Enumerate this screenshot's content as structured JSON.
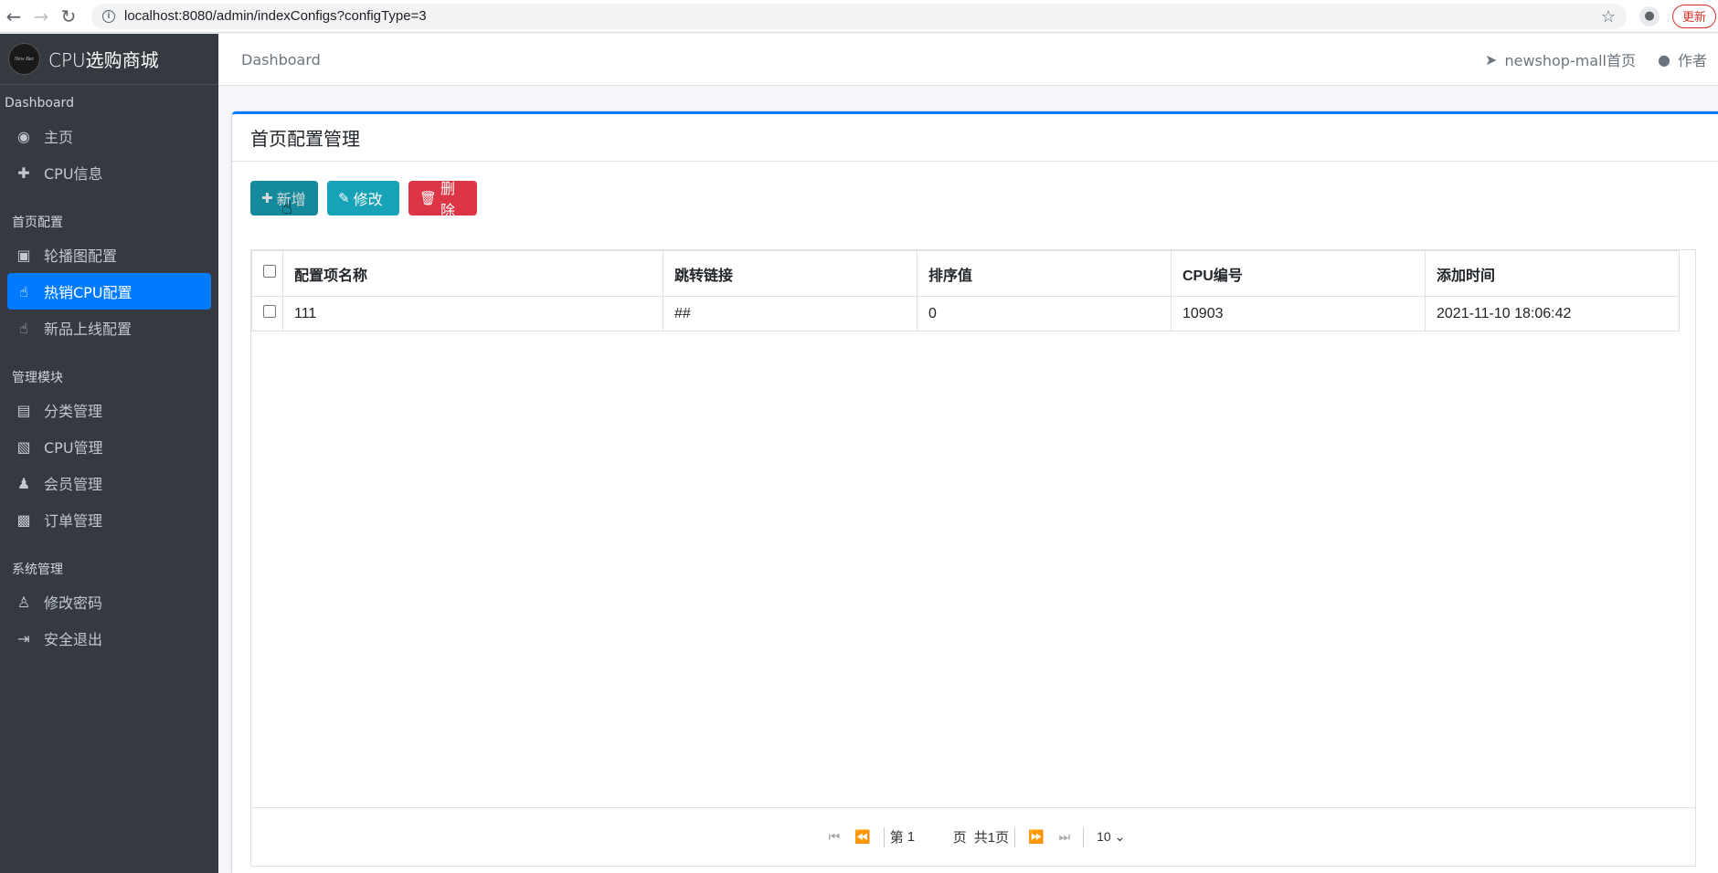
{
  "browser": {
    "url": "localhost:8080/admin/indexConfigs?configType=3",
    "update_label": "更新"
  },
  "sidebar": {
    "brand_logo_text": "New Bee",
    "brand_title": "CPU选购商城",
    "sections": [
      {
        "header": "Dashboard",
        "items": [
          {
            "label": "主页",
            "icon": "dashboard-icon"
          },
          {
            "label": "CPU信息",
            "icon": "plus-icon"
          }
        ]
      },
      {
        "header": "首页配置",
        "items": [
          {
            "label": "轮播图配置",
            "icon": "image-icon"
          },
          {
            "label": "热销CPU配置",
            "icon": "hand-pointer-icon",
            "active": true
          },
          {
            "label": "新品上线配置",
            "icon": "hand-pointer-icon"
          }
        ]
      },
      {
        "header": "管理模块",
        "items": [
          {
            "label": "分类管理",
            "icon": "list-icon"
          },
          {
            "label": "CPU管理",
            "icon": "archive-icon"
          },
          {
            "label": "会员管理",
            "icon": "users-icon"
          },
          {
            "label": "订单管理",
            "icon": "money-icon"
          }
        ]
      },
      {
        "header": "系统管理",
        "items": [
          {
            "label": "修改密码",
            "icon": "user-secret-icon"
          },
          {
            "label": "安全退出",
            "icon": "sign-out-icon"
          }
        ]
      }
    ]
  },
  "topnav": {
    "breadcrumb": "Dashboard",
    "home_link": "newshop-mall首页",
    "author_link": "作者"
  },
  "card": {
    "title": "首页配置管理",
    "buttons": {
      "add": "新增",
      "edit": "修改",
      "delete": "删除"
    }
  },
  "table": {
    "columns": [
      "配置项名称",
      "跳转链接",
      "排序值",
      "CPU编号",
      "添加时间"
    ],
    "rows": [
      [
        "111",
        "##",
        "0",
        "10903",
        "2021-11-10 18:06:42"
      ]
    ]
  },
  "pager": {
    "page_prefix": "第",
    "current_page": "1",
    "page_suffix": "页",
    "total": "共1页",
    "page_size": "10"
  }
}
